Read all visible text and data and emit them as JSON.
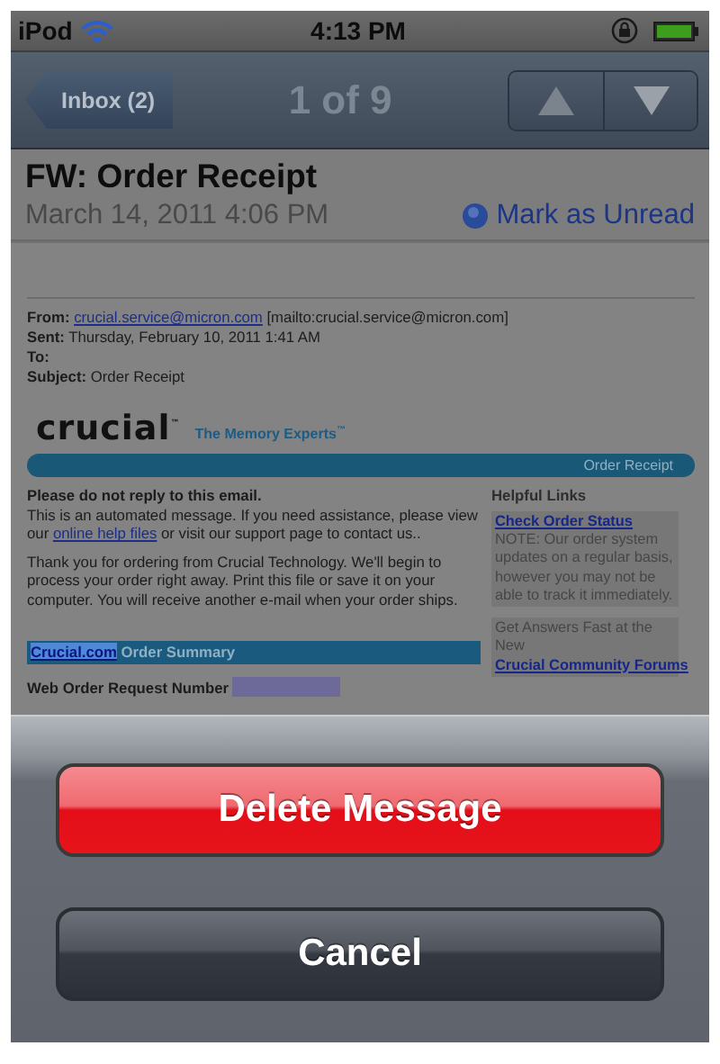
{
  "status_bar": {
    "carrier": "iPod",
    "time": "4:13 PM"
  },
  "nav_bar": {
    "back": "Inbox (2)",
    "position": "1 of 9"
  },
  "message": {
    "subject": "FW: Order Receipt",
    "date": "March 14, 2011 4:06 PM",
    "mark_unread": "Mark as Unread"
  },
  "email": {
    "header": [
      {
        "label": "From:",
        "link": "crucial.service@micron.com",
        "text": "[mailto:crucial.service@micron.com]"
      },
      {
        "label": "Sent:",
        "text": "Thursday, February 10, 2011 1:41 AM"
      },
      {
        "label": "To:"
      },
      {
        "label": "Subject:",
        "text": "Order Receipt"
      }
    ],
    "brand": {
      "logo": "crucial$^{™}$",
      "tagline": "The Memory Experts$^{™}$",
      "banner": "Order Receipt"
    },
    "notice_title": "Please do not reply to this email.",
    "notice": [
      {
        "text": "This is an automated message. If you need assistance, please view our"
      },
      {
        "link": "online help files"
      },
      {
        "text": "or visit our support page to contact us.."
      }
    ],
    "thanks": "Thank you for ordering from Crucial Technology. We'll begin to process your order right away. Print this file or save it on your computer. You will receive another e-mail when your order ships.",
    "summary_bar": {
      "link": "Crucial.com",
      "text": "Order Summary"
    },
    "order_number_label": "Web Order Request Number",
    "sidebar": {
      "title": "Helpful Links",
      "boxes": [
        [
          {
            "link": "Check Order Status"
          },
          {
            "text": "NOTE: Our order system updates on a regular basis, however you may not be able to track it immediately."
          }
        ],
        [
          {
            "text": "Get Answers Fast at the New"
          },
          {
            "link": "Crucial Community Forums"
          }
        ]
      ]
    }
  },
  "action_sheet": {
    "buttons": [
      {
        "label": "Delete Message",
        "kind": "destructive"
      },
      {
        "label": "Cancel",
        "kind": "cancel"
      }
    ]
  }
}
